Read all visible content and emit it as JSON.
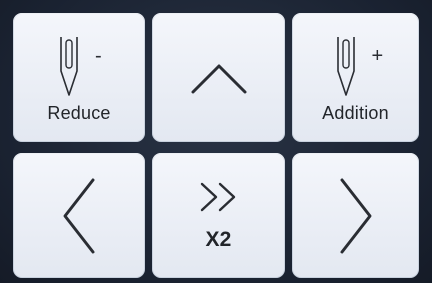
{
  "panel": {
    "reduce": {
      "label": "Reduce",
      "sign": "-",
      "icon": "needle-icon"
    },
    "up": {
      "icon": "chevron-up-icon"
    },
    "addition": {
      "label": "Addition",
      "sign": "+",
      "icon": "needle-icon"
    },
    "left": {
      "icon": "chevron-left-icon"
    },
    "speed": {
      "label": "X2",
      "icon": "double-chevron-right-icon"
    },
    "right": {
      "icon": "chevron-right-icon"
    }
  },
  "colors": {
    "button_face": "#eef1f7",
    "background": "#1b2433",
    "icon": "#2a2d33"
  }
}
